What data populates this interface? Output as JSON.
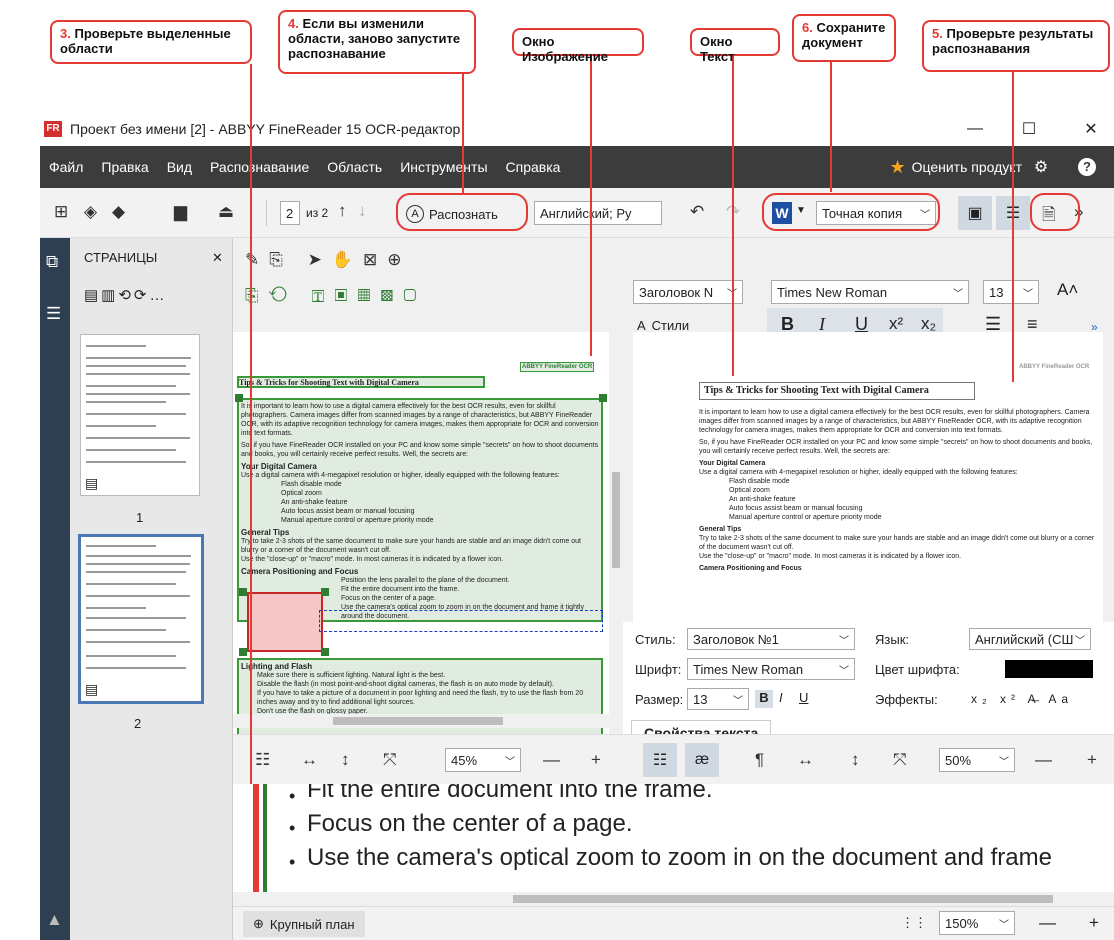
{
  "callouts": {
    "c3_num": "3.",
    "c3_text": "Проверьте выделенные области",
    "c4_num": "4.",
    "c4_text": "Если вы изменили области, заново запустите распознавание",
    "image_window": "Окно Изображение",
    "text_window": "Окно Текст",
    "c6_num": "6.",
    "c6_text": "Сохраните документ",
    "c5_num": "5.",
    "c5_text": "Проверьте результаты распознавания"
  },
  "window": {
    "title": "Проект без имени [2] - ABBYY FineReader 15 OCR-редактор",
    "app_icon": "FR",
    "minimize": "—",
    "maximize": "☐",
    "close": "✕"
  },
  "menu": {
    "items": [
      "Файл",
      "Правка",
      "Вид",
      "Распознавание",
      "Область",
      "Инструменты",
      "Справка"
    ],
    "rate": "Оценить продукт"
  },
  "toolbar": {
    "page_current": "2",
    "page_of": "из 2",
    "recognize": "Распознать",
    "language": "Английский; Ру",
    "save_format": "Точная копия"
  },
  "pages_panel": {
    "title": "СТРАНИЦЫ",
    "close": "✕",
    "page1": "1",
    "page2": "2"
  },
  "image_doc": {
    "logo": "ABBYY FineReader OCR",
    "title": "Tips & Tricks for Shooting Text with Digital Camera",
    "p1": "It is important to learn how to use a digital camera effectively for the best OCR results, even for skillful photographers. Camera images differ from scanned images by a range of characteristics, but ABBYY FineReader OCR, with its adaptive recognition technology for camera images, makes them appropriate for OCR and conversion into text formats.",
    "p2": "So, if you have FineReader OCR installed on your PC and know some simple \"secrets\" on how to shoot documents and books, you will certainly receive perfect results. Well, the secrets are:",
    "h1": "Your Digital Camera",
    "p3": "Use a digital camera with 4-megapixel resolution or higher, ideally equipped with the following features:",
    "b1": "Flash disable mode",
    "b2": "Optical zoom",
    "b3": "An anti-shake feature",
    "b4": "Auto focus assist beam or manual focusing",
    "b5": "Manual aperture control or aperture priority mode",
    "h2": "General Tips",
    "p4": "Try to take 2-3 shots of the same document to make sure your hands are stable and an image didn't come out blurry or a corner of the document wasn't cut off.",
    "p5": "Use the \"close-up\" or \"macro\" mode. In most cameras it is indicated by a flower icon.",
    "h3": "Camera Positioning and Focus",
    "c1": "Position the lens parallel to the plane of the document.",
    "c2": "Fit the entire document into the frame.",
    "c3": "Focus on the center of a page.",
    "c4": "Use the camera's optical zoom to zoom in on the document and frame it tightly around the document.",
    "h4": "Lighting and Flash",
    "l1": "Make sure there is sufficient lighting. Natural light is the best.",
    "l2": "Disable the flash (in most point-and-shoot digital cameras, the flash is on auto mode by default).",
    "l3": "If you have to take a picture of a document in poor lighting and need the flash, try to use the flash from 20 inches away and try to find additional light sources.",
    "l4": "Don't use the flash on glossy paper."
  },
  "text_toolbar": {
    "style": "Заголовок N",
    "font": "Times New Roman",
    "size": "13",
    "styles_btn": "Стили"
  },
  "text_doc": {
    "logo": "ABBYY FineReader OCR",
    "title": "Tips & Tricks for Shooting Text with Digital Camera"
  },
  "props": {
    "style_label": "Стиль:",
    "style_value": "Заголовок №1",
    "lang_label": "Язык:",
    "lang_value": "Английский (СШ",
    "font_label": "Шрифт:",
    "font_value": "Times New Roman",
    "color_label": "Цвет шрифта:",
    "size_label": "Размер:",
    "size_value": "13",
    "effects_label": "Эффекты:",
    "tab": "Свойства текста"
  },
  "zoom": {
    "image_zoom": "45%",
    "text_zoom": "50%",
    "closeup_zoom": "150%",
    "closeup_btn": "Крупный план"
  },
  "closeup_text": {
    "line1": "Fit the entire document into the frame.",
    "line2": "Focus on the center of a page.",
    "line3": "Use the camera's optical zoom to zoom in on the document and frame"
  }
}
